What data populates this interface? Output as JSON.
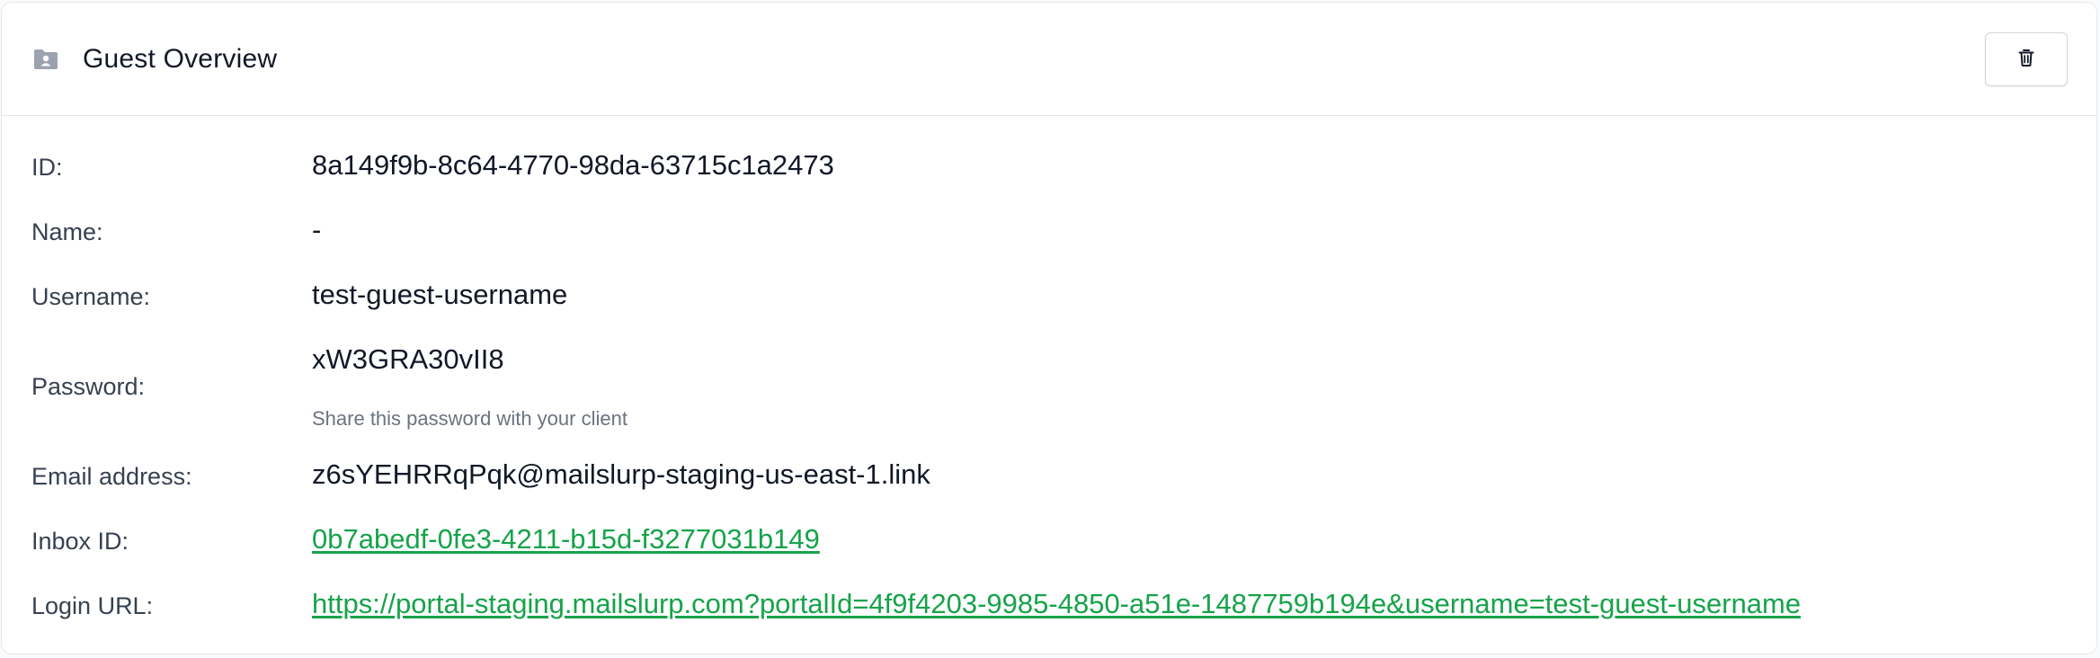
{
  "header": {
    "title": "Guest Overview",
    "folder_icon": "folder-user-icon",
    "delete_icon": "trash-icon"
  },
  "fields": {
    "id": {
      "label": "ID:",
      "value": "8a149f9b-8c64-4770-98da-63715c1a2473"
    },
    "name": {
      "label": "Name:",
      "value": "-"
    },
    "username": {
      "label": "Username:",
      "value": "test-guest-username"
    },
    "password": {
      "label": "Password:",
      "value": "xW3GRA30vII8",
      "hint": "Share this password with your client"
    },
    "email": {
      "label": "Email address:",
      "value": "z6sYEHRRqPqk@mailslurp-staging-us-east-1.link"
    },
    "inbox": {
      "label": "Inbox ID:",
      "value": "0b7abedf-0fe3-4211-b15d-f3277031b149"
    },
    "login_url": {
      "label": "Login URL:",
      "value": "https://portal-staging.mailslurp.com?portalId=4f9f4203-9985-4850-a51e-1487759b194e&username=test-guest-username"
    }
  },
  "colors": {
    "link": "#16a34a",
    "label": "#374151",
    "value": "#111827",
    "hint": "#6b7280",
    "icon": "#9ca3af"
  }
}
